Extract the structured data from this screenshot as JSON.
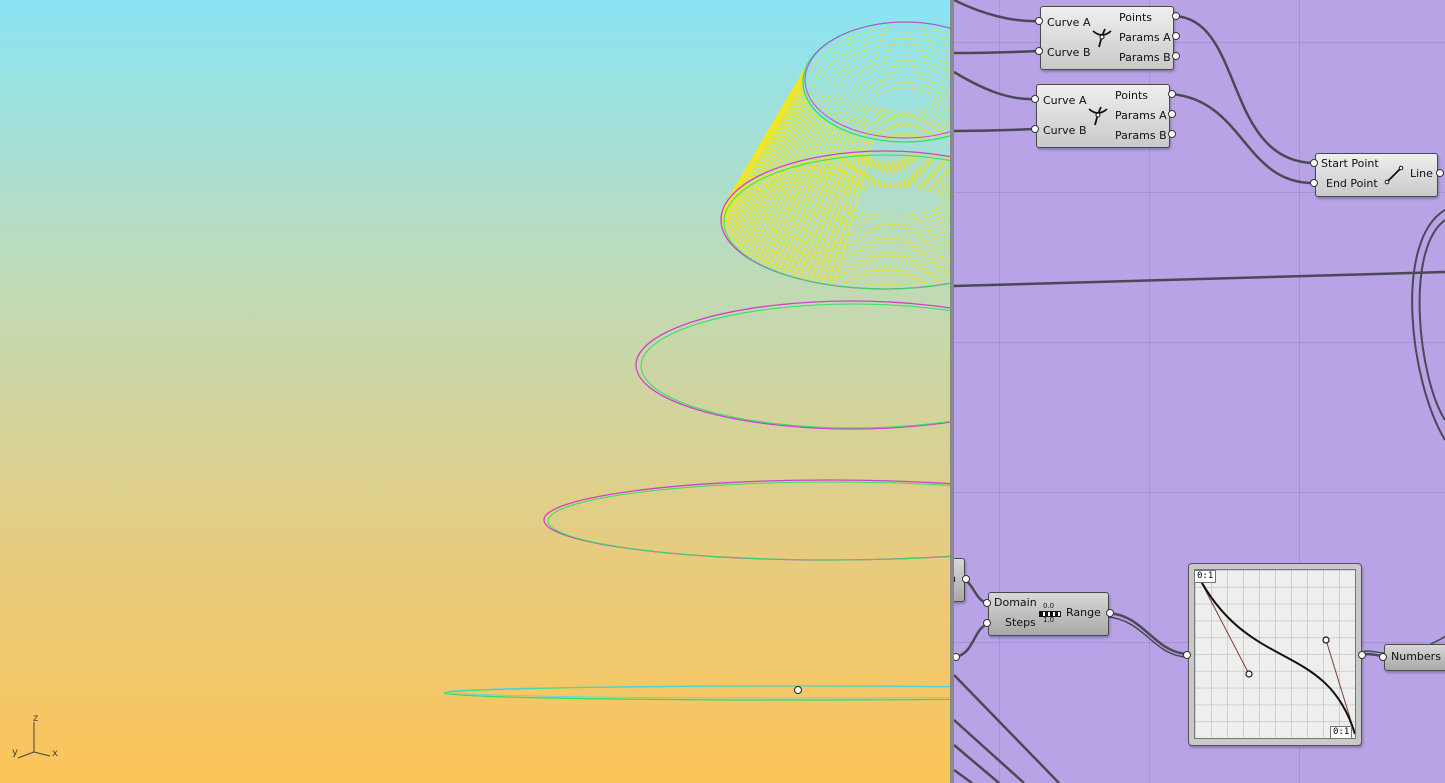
{
  "viewport": {
    "axis": {
      "z": "z",
      "y": "y",
      "x": "x"
    }
  },
  "canvas": {
    "intersect_1": {
      "inputs": [
        "Curve A",
        "Curve B"
      ],
      "outputs": [
        "Points",
        "Params A",
        "Params B"
      ]
    },
    "intersect_2": {
      "inputs": [
        "Curve A",
        "Curve B"
      ],
      "outputs": [
        "Points",
        "Params A",
        "Params B"
      ]
    },
    "line": {
      "inputs": [
        "Start Point",
        "End Point"
      ],
      "output": "Line"
    },
    "range": {
      "inputs": [
        "Domain",
        "Steps"
      ],
      "output": "Range",
      "icon_top": "0.0",
      "icon_bottom": "1.0"
    },
    "graph_mapper": {
      "tag_top": "0:1",
      "tag_bottom": "0:1"
    },
    "numbers": {
      "label": "Numbers"
    },
    "partial": {
      "label": "n"
    }
  },
  "colors": {
    "viewport_top": "#8ae4f5",
    "viewport_bottom": "#fcc458",
    "canvas_bg": "#b7a3e6",
    "curve_yellow": "#ffe800",
    "curve_magenta": "#d040d0",
    "curve_green": "#30e060",
    "wire": "#4a4a55"
  }
}
